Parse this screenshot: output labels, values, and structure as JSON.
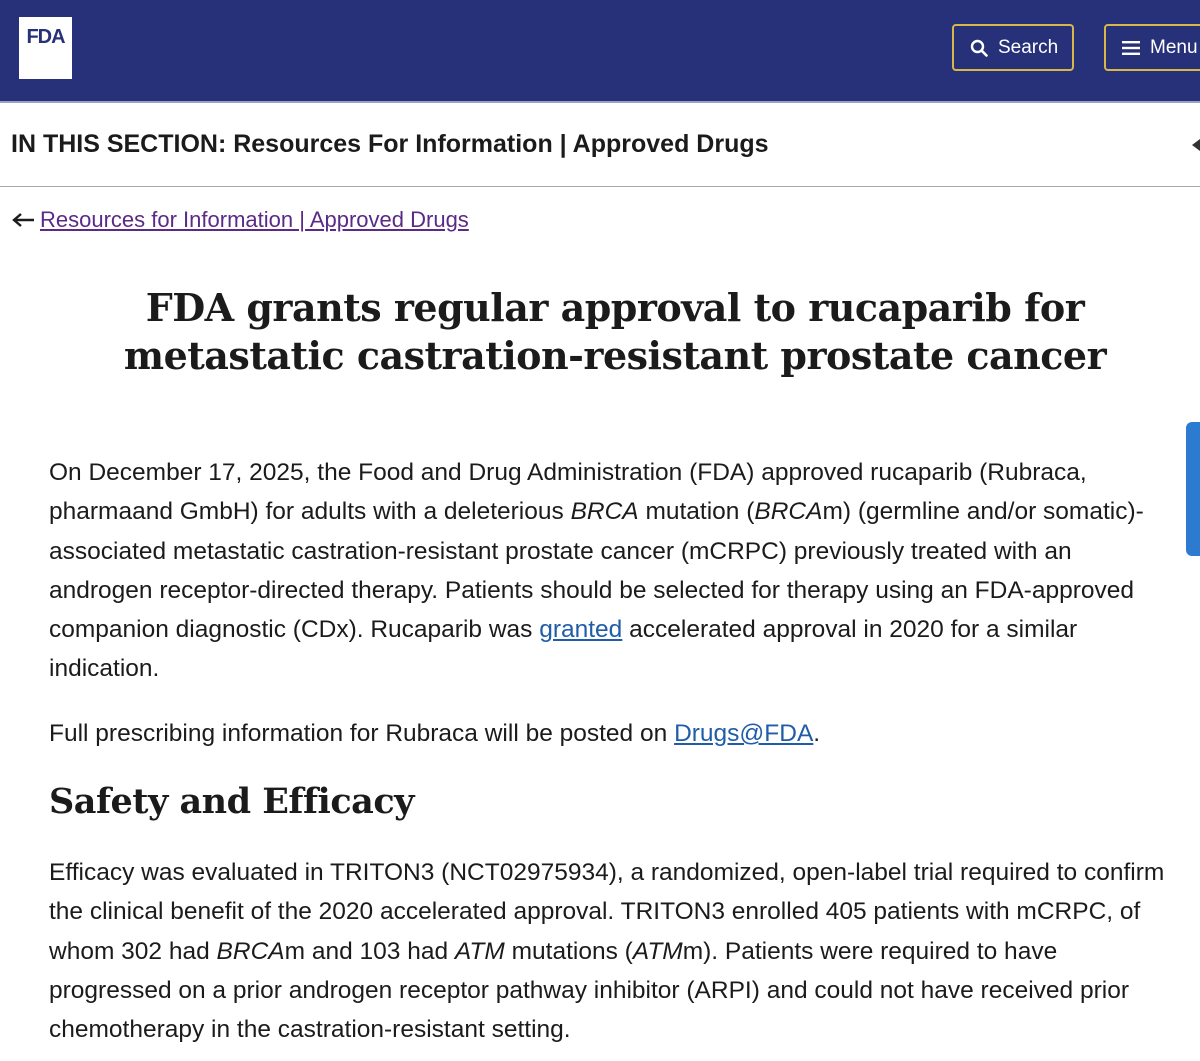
{
  "header": {
    "logo_text": "FDA",
    "search_label": "Search",
    "menu_label": "Menu",
    "accent_color": "#263179",
    "button_border_color": "#d9b64a"
  },
  "section": {
    "label": "IN THIS SECTION: Resources For Information | Approved Drugs"
  },
  "back_link": {
    "label": "Resources for Information | Approved Drugs"
  },
  "article": {
    "title": "FDA grants regular approval to rucaparib for metastatic castration-resistant prostate cancer",
    "p1": {
      "s1": "On December 17, 2025, the Food and Drug Administration (FDA) approved rucaparib (Rubraca, pharmaand GmbH) for adults with a deleterious ",
      "i1": "BRCA",
      "s2": " mutation (",
      "i2": "BRCA",
      "s3": "m) (germline and/or somatic)-associated metastatic castration-resistant prostate cancer (mCRPC) previously treated with an androgen receptor-directed therapy. Patients should be selected for therapy using an FDA-approved companion diagnostic (CDx). Rucaparib was ",
      "link": "granted",
      "s4": " accelerated approval in 2020 for a similar indication."
    },
    "p2": {
      "s1": "Full prescribing information for Rubraca will be posted on ",
      "link": "Drugs@FDA",
      "s2": "."
    },
    "heading": "Safety and Efficacy",
    "p3": {
      "s1": "Efficacy was evaluated in TRITON3 (NCT02975934), a randomized, open-label trial required to confirm the clinical benefit of the 2020 accelerated approval. TRITON3 enrolled 405 patients with mCRPC, of whom 302 had ",
      "i1": "BRCA",
      "s2": "m and 103 had ",
      "i2": "ATM",
      "s3": " mutations (",
      "i3": "ATM",
      "s4": "m). Patients were required to have progressed on a prior androgen receptor pathway inhibitor (ARPI) and could not have received prior chemotherapy in the castration-resistant setting."
    }
  }
}
